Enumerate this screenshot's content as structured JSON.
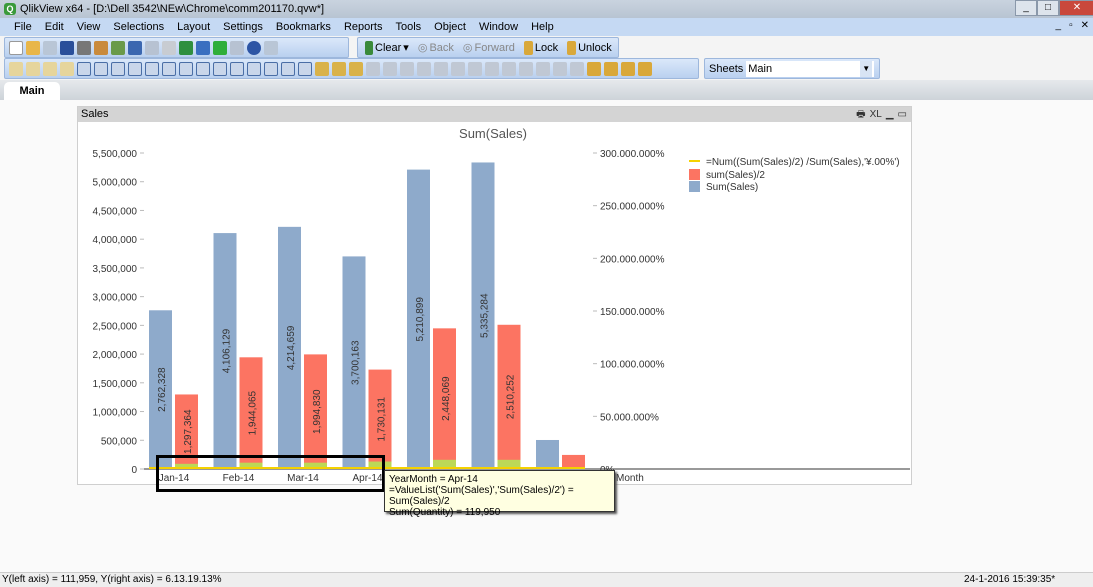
{
  "window": {
    "title": "QlikView x64 - [D:\\Dell 3542\\NEw\\Chrome\\comm201170.qvw*]",
    "controls": [
      "_",
      "□",
      "✕"
    ]
  },
  "menu": [
    "File",
    "Edit",
    "View",
    "Selections",
    "Layout",
    "Settings",
    "Bookmarks",
    "Reports",
    "Tools",
    "Object",
    "Window",
    "Help"
  ],
  "toolbar": {
    "clear": "Clear",
    "back": "Back",
    "forward": "Forward",
    "lock": "Lock",
    "unlock": "Unlock",
    "sheets_label": "Sheets",
    "sheets_value": "Main"
  },
  "tabs": [
    {
      "label": "Main",
      "active": true
    }
  ],
  "object": {
    "caption": "Sales",
    "caption_icons": [
      "print-icon",
      "xl-icon",
      "minimize-icon",
      "maximize-icon"
    ],
    "xl": "XL"
  },
  "chart_data": {
    "type": "bar",
    "title": "Sum(Sales)",
    "xlabel": "Month",
    "categories": [
      "Jan-14",
      "Feb-14",
      "Mar-14",
      "Apr-14",
      "",
      "",
      ""
    ],
    "left_axis": {
      "ylim": [
        0,
        5500000
      ],
      "ticks": [
        "0",
        "500,000",
        "1,000,000",
        "1,500,000",
        "2,000,000",
        "2,500,000",
        "3,000,000",
        "3,500,000",
        "4,000,000",
        "4,500,000",
        "5,000,000",
        "5,500,000"
      ]
    },
    "right_axis": {
      "ticks": [
        "0%",
        "50.000.000%",
        "100.000.000%",
        "150.000.000%",
        "200.000.000%",
        "250.000.000%",
        "300.000.000%"
      ]
    },
    "series": [
      {
        "name": "Sum(Sales)",
        "color": "#8eaacb",
        "values": [
          2762328,
          4106129,
          4214659,
          3700163,
          5210899,
          5335284,
          505000
        ],
        "labels": [
          "2,762,328",
          "4,106,129",
          "4,214,659",
          "3,700,163",
          "5,210,899",
          "5,335,284",
          ""
        ]
      },
      {
        "name": "sum(Sales)/2",
        "color": "#fc7462",
        "values": [
          1297364,
          1944065,
          1994830,
          1730131,
          2448069,
          2510252,
          245000
        ],
        "labels": [
          "1,297,364",
          "1,944,065",
          "1,994,830",
          "1,730,131",
          "2,448,069",
          "2,510,252",
          ""
        ]
      },
      {
        "name": "=Num((Sum(Sales)/2) /Sum(Sales),'¥.00%')",
        "color": "#f5d200",
        "type": "line",
        "values": [
          0,
          0,
          0,
          0,
          0,
          0,
          0
        ]
      }
    ],
    "green_segment": {
      "color": "#bcd857",
      "values": [
        90000,
        110000,
        110000,
        130000,
        160000,
        160000,
        0
      ]
    },
    "legend": "top-right"
  },
  "tooltip": [
    "YearMonth = Apr-14",
    "=ValueList('Sum(Sales)','Sum(Sales)/2') = Sum(Sales)/2",
    "Sum(Quantity) = 119,950"
  ],
  "status": {
    "left": "Y(left axis) = 111,959, Y(right axis) = 6.13.19.13%",
    "right": "24-1-2016 15:39:35*"
  }
}
